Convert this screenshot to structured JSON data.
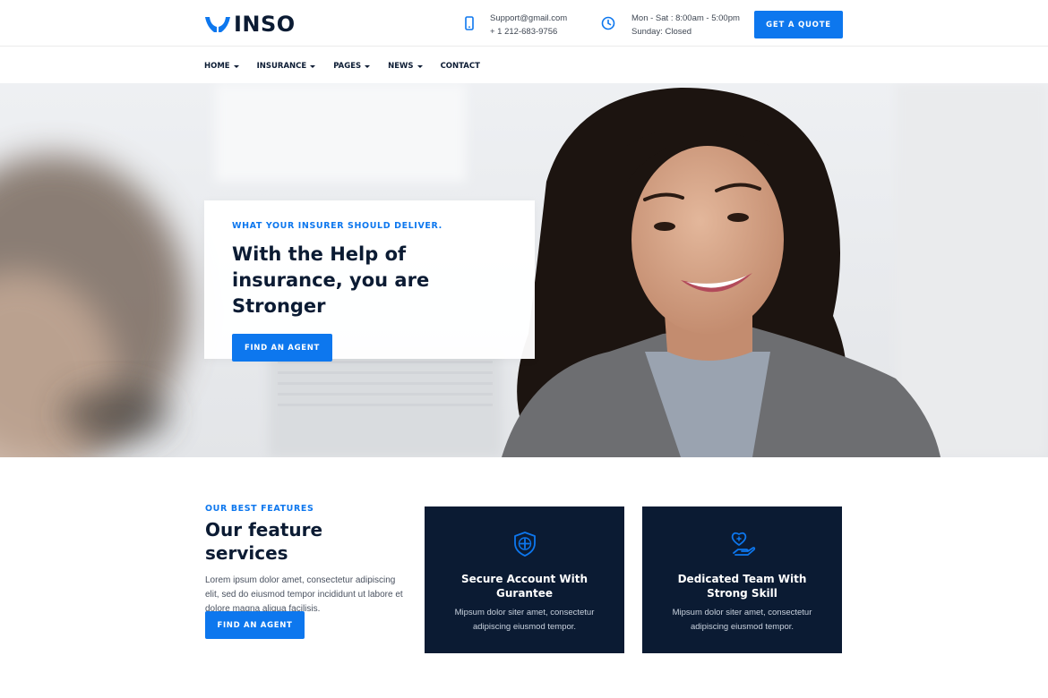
{
  "header": {
    "logo_text": "INSO",
    "email": "Support@gmail.com",
    "phone": "+ 1 212-683-9756",
    "hours_weekday": "Mon - Sat : 8:00am - 5:00pm",
    "hours_sunday": "Sunday: Closed",
    "quote_button": "GET A QUOTE"
  },
  "nav": {
    "items": [
      {
        "label": "HOME",
        "has_dropdown": true
      },
      {
        "label": "INSURANCE",
        "has_dropdown": true
      },
      {
        "label": "PAGES",
        "has_dropdown": true
      },
      {
        "label": "NEWS",
        "has_dropdown": true
      },
      {
        "label": "CONTACT",
        "has_dropdown": false
      }
    ]
  },
  "hero": {
    "kicker": "WHAT YOUR INSURER SHOULD DELIVER.",
    "title": "With the Help of insurance, you are Stronger",
    "button": "FIND AN AGENT"
  },
  "features": {
    "kicker": "OUR BEST FEATURES",
    "title": "Our feature services",
    "description": "Lorem ipsum dolor amet, consectetur adipiscing elit, sed do eiusmod tempor incididunt ut labore et dolore magna aliqua facilisis.",
    "button": "FIND AN AGENT",
    "cards": [
      {
        "icon": "shield-plus-icon",
        "title": "Secure Account With Gurantee",
        "text": "Mipsum dolor siter amet, consectetur adipiscing eiusmod tempor."
      },
      {
        "icon": "heart-hand-icon",
        "title": "Dedicated Team With Strong Skill",
        "text": "Mipsum dolor siter amet, consectetur adipiscing eiusmod tempor."
      }
    ]
  },
  "icons": {
    "phone": "mobile-phone-icon",
    "hours": "clock-icon"
  },
  "colors": {
    "accent": "#0d77ee",
    "dark": "#0b1b33",
    "card_bg": "#0b1b33"
  }
}
